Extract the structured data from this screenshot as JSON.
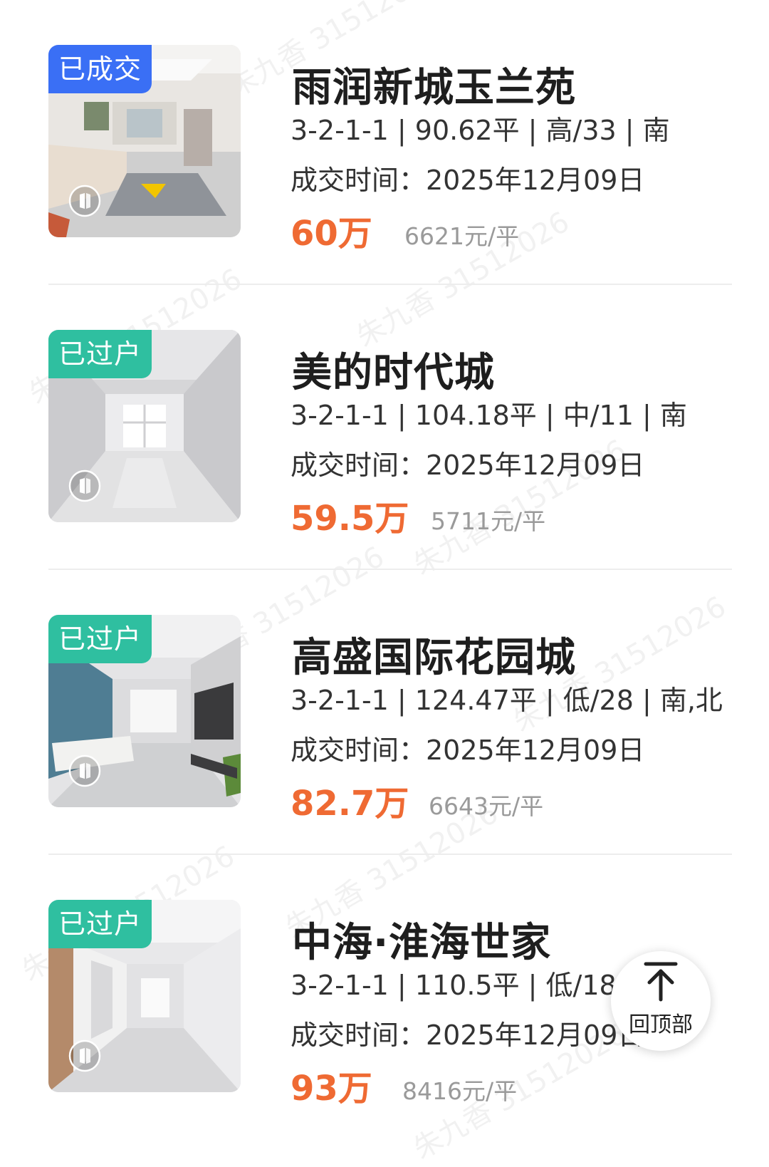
{
  "listings": [
    {
      "badge": "已成交",
      "badge_color": "#3a6ff5",
      "title": "雨润新城玉兰苑",
      "specs": "3-2-1-1 | 90.62平 | 高/33 | 南",
      "deal_time": "成交时间：2025年12月09日",
      "price": "60万",
      "unit_price": "6621元/平",
      "photo_icon": "vr-tour-icon"
    },
    {
      "badge": "已过户",
      "badge_color": "#2fbfa0",
      "title": "美的时代城",
      "specs": "3-2-1-1 | 104.18平 | 中/11 | 南",
      "deal_time": "成交时间：2025年12月09日",
      "price": "59.5万",
      "unit_price": "5711元/平",
      "photo_icon": "vr-tour-icon"
    },
    {
      "badge": "已过户",
      "badge_color": "#2fbfa0",
      "title": "高盛国际花园城",
      "specs": "3-2-1-1 | 124.47平 | 低/28 | 南,北",
      "deal_time": "成交时间：2025年12月09日",
      "price": "82.7万",
      "unit_price": "6643元/平",
      "photo_icon": "vr-tour-icon"
    },
    {
      "badge": "已过户",
      "badge_color": "#2fbfa0",
      "title": "中海·淮海世家",
      "specs": "3-2-1-1 | 110.5平 | 低/18 | ",
      "deal_time": "成交时间：2025年12月09日",
      "price": "93万",
      "unit_price": "8416元/平",
      "photo_icon": "vr-tour-icon"
    }
  ],
  "back_to_top": {
    "label": "回顶部",
    "icon": "arrow-up-icon"
  },
  "watermark": {
    "text": "朱九香 31512026"
  },
  "colors": {
    "price": "#ef6a33",
    "unit_price": "#9a9a9a",
    "badge_deal": "#3a6ff5",
    "badge_transfer": "#2fbfa0"
  }
}
